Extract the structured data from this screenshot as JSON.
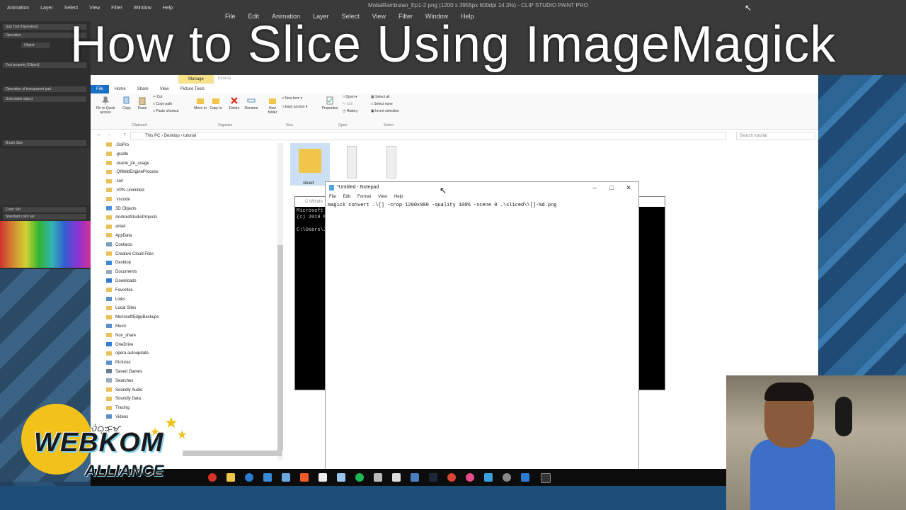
{
  "video": {
    "title": "How to Slice Using ImageMagick"
  },
  "clip_studio": {
    "window_title": "MobaRambulan_Ep1-2.png (1200 x 3955px 600dpi 14.3%) - CLIP STUDIO PAINT PRO",
    "menu_left": [
      "Animation",
      "Layer",
      "Select",
      "View",
      "Filter",
      "Window",
      "Help"
    ],
    "menu": [
      "File",
      "Edit",
      "Animation",
      "Layer",
      "Select",
      "View",
      "Filter",
      "Window",
      "Help"
    ],
    "panel_rows": [
      "Sub Tool [Operation]",
      "Operation",
      "Object",
      "Tool property [Object]",
      "Operation of transparent part",
      "Selectable object",
      "Brush Size",
      "Color Set",
      "Standard color set"
    ],
    "select_layer": "Select layer"
  },
  "explorer": {
    "ribbon_tab_manage": "Manage",
    "folder_name": "tutorial",
    "tabs": [
      "File",
      "Home",
      "Share",
      "View",
      "Picture Tools"
    ],
    "ribbon": {
      "pin": "Pin to Quick access",
      "copy": "Copy",
      "paste": "Paste",
      "cut": "Cut",
      "copy_path": "Copy path",
      "paste_shortcut": "Paste shortcut",
      "move_to": "Move to",
      "copy_to": "Copy to",
      "delete": "Delete",
      "rename": "Rename",
      "new_folder": "New folder",
      "new_item": "New item",
      "easy_access": "Easy access",
      "properties": "Properties",
      "open": "Open",
      "edit": "Edit",
      "history": "History",
      "select_all": "Select all",
      "select_none": "Select none",
      "invert_selection": "Invert selection",
      "group_clipboard": "Clipboard",
      "group_organize": "Organize",
      "group_new": "New",
      "group_open": "Open",
      "group_select": "Select"
    },
    "address": [
      "This PC",
      "Desktop",
      "tutorial"
    ],
    "search_placeholder": "Search tutorial",
    "nav_items": [
      ".GoPro",
      ".gradle",
      ".oracle_jre_usage",
      ".QtWebEngineProcess",
      ".swt",
      ".VPN Unlimited",
      ".vscode",
      "3D Objects",
      "AndroidStudioProjects",
      "ansel",
      "AppData",
      "Contacts",
      "Creative Cloud Files",
      "Desktop",
      "Documents",
      "Downloads",
      "Favorites",
      "Links",
      "Local Sites",
      "MicrosoftEdgeBackups",
      "Music",
      "Nox_share",
      "OneDrive",
      "opera autoupdate",
      "Pictures",
      "Saved Games",
      "Searches",
      "Soundly Audio",
      "Soundly Data",
      "Tracing",
      "Videos"
    ],
    "folder_label": "sliced"
  },
  "cmd": {
    "title": "C:\\Windo",
    "lines": [
      "Microsoft",
      "(c) 2019 M",
      "",
      "C:\\Users\\J"
    ]
  },
  "notepad": {
    "title": "*Untitled - Notepad",
    "menu": [
      "File",
      "Edit",
      "Format",
      "View",
      "Help"
    ],
    "content": "magick convert .\\[] -crop 1200x900 -quality 100% -scene 0 .\\sliced\\\\[]-%d.png"
  },
  "logo": {
    "line1": "WEBKOM",
    "line2": "ALLIANCE",
    "script": "ᜏᜒᜊ᜔ᜃᜓᜋ᜔"
  },
  "colors": {
    "explorer_file_tab": "#1a6fc6",
    "manage_tab": "#f5e28a",
    "logo_yellow": "#f2c21a"
  }
}
